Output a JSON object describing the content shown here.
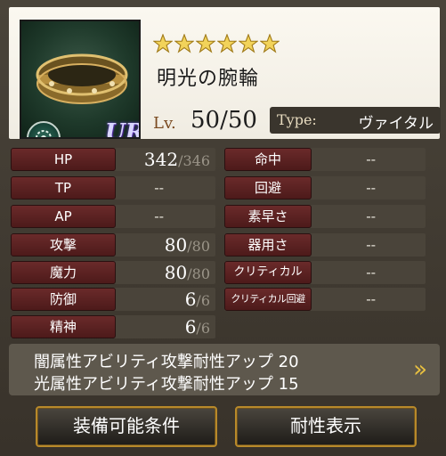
{
  "item": {
    "name": "明光の腕輪",
    "rarity_stars": 6,
    "rarity_badge": "UR",
    "level_label": "Lv.",
    "level_value": "50/50",
    "type_label": "Type:",
    "type_value": "ヴァイタル"
  },
  "stats_left": [
    {
      "label": "HP",
      "value": "342",
      "max": "/346"
    },
    {
      "label": "TP",
      "value": "--",
      "max": ""
    },
    {
      "label": "AP",
      "value": "--",
      "max": ""
    },
    {
      "label": "攻撃",
      "value": "80",
      "max": "/80"
    },
    {
      "label": "魔力",
      "value": "80",
      "max": "/80"
    },
    {
      "label": "防御",
      "value": "6",
      "max": "/6"
    },
    {
      "label": "精神",
      "value": "6",
      "max": "/6"
    }
  ],
  "stats_right": [
    {
      "label": "命中",
      "value": "--"
    },
    {
      "label": "回避",
      "value": "--"
    },
    {
      "label": "素早さ",
      "value": "--"
    },
    {
      "label": "器用さ",
      "value": "--"
    },
    {
      "label": "クリティカル",
      "value": "--"
    },
    {
      "label": "クリティカル回避",
      "value": "--"
    }
  ],
  "abilities": [
    "闇属性アビリティ攻撃耐性アップ 20",
    "光属性アビリティ攻撃耐性アップ 15"
  ],
  "ability_more": "»",
  "buttons": {
    "equip_conditions": "装備可能条件",
    "resistance": "耐性表示"
  },
  "colors": {
    "stat_label_bg": "#6a2a2a",
    "accent_gold": "#e8c040",
    "type_bg": "#3a352d"
  }
}
